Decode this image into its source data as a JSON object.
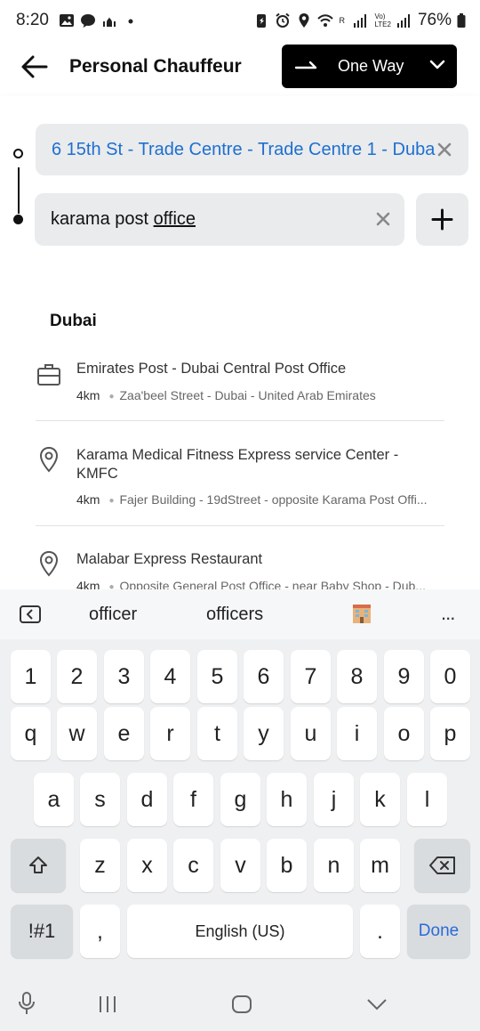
{
  "status_bar": {
    "time": "8:20",
    "battery": "76%",
    "icons": [
      "gallery-icon",
      "chat-icon",
      "mosque-icon",
      "dot-icon",
      "battery-saver-icon",
      "alarm-icon",
      "location-icon",
      "wifi-icon",
      "signal-icon",
      "signal-icon"
    ],
    "network_labels": [
      "R",
      "Vo)",
      "LTE2"
    ]
  },
  "header": {
    "title": "Personal Chauffeur",
    "trip_type": "One Way"
  },
  "route": {
    "pickup": "6 15th St - Trade Centre - Trade Centre 1 - Dubai",
    "dropoff_plain": "karama post ",
    "dropoff_underlined": "office"
  },
  "results": {
    "section": "Dubai",
    "items": [
      {
        "icon": "briefcase-icon",
        "name": "Emirates Post - Dubai Central Post Office",
        "distance": "4km",
        "address": "Zaa'beel Street - Dubai - United Arab Emirates"
      },
      {
        "icon": "location-pin-icon",
        "name": "Karama Medical Fitness Express service Center - KMFC",
        "distance": "4km",
        "address": "Fajer Building - 19dStreet - opposite Karama Post Offi..."
      },
      {
        "icon": "location-pin-icon",
        "name": "Malabar Express Restaurant",
        "distance": "4km",
        "address": "Opposite General Post Office - near Baby Shop - Dub..."
      }
    ]
  },
  "keyboard": {
    "suggestions": [
      "officer",
      "officers"
    ],
    "more": "...",
    "row_numbers": [
      "1",
      "2",
      "3",
      "4",
      "5",
      "6",
      "7",
      "8",
      "9",
      "0"
    ],
    "row1": [
      "q",
      "w",
      "e",
      "r",
      "t",
      "y",
      "u",
      "i",
      "o",
      "p"
    ],
    "row2": [
      "a",
      "s",
      "d",
      "f",
      "g",
      "h",
      "j",
      "k",
      "l"
    ],
    "row3": [
      "z",
      "x",
      "c",
      "v",
      "b",
      "n",
      "m"
    ],
    "symbols": "!#1",
    "comma": ",",
    "space": "English (US)",
    "period": ".",
    "done": "Done"
  }
}
